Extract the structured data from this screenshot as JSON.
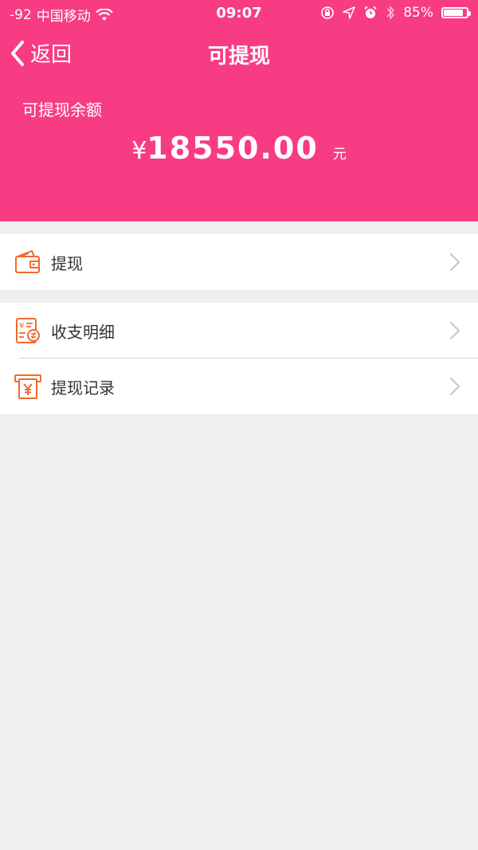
{
  "status_bar": {
    "signal": "-92",
    "carrier": "中国移动",
    "time": "09:07",
    "battery_text": "85%",
    "battery_level": 0.85
  },
  "nav": {
    "back_label": "返回",
    "title": "可提现"
  },
  "balance": {
    "label": "可提现余额",
    "currency_symbol": "¥",
    "amount": "18550.00",
    "unit": "元"
  },
  "menu_group_1": [
    {
      "label": "提现",
      "icon": "wallet-icon"
    }
  ],
  "menu_group_2": [
    {
      "label": "收支明细",
      "icon": "ledger-icon"
    },
    {
      "label": "提现记录",
      "icon": "atm-withdraw-icon"
    }
  ],
  "colors": {
    "header_bg": "#f73c84",
    "icon_orange": "#f06a2d",
    "page_bg": "#efeff0"
  }
}
